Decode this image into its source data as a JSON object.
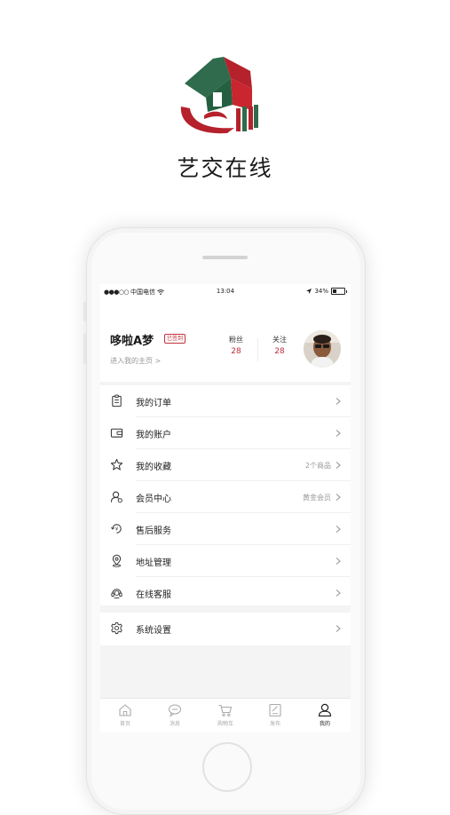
{
  "app": {
    "name": "艺交在线"
  },
  "status_bar": {
    "carrier": "中国电信",
    "time": "13:04",
    "battery": "34%"
  },
  "profile": {
    "username": "哆啦A梦",
    "badge": "已签到",
    "home_link": "进入我的主页 >",
    "fans_label": "粉丝",
    "fans_count": "28",
    "follow_label": "关注",
    "follow_count": "28"
  },
  "menu": {
    "items": [
      {
        "label": "我的订单",
        "value": "",
        "icon": "clipboard-icon"
      },
      {
        "label": "我的账户",
        "value": "",
        "icon": "wallet-icon"
      },
      {
        "label": "我的收藏",
        "value": "2个商品",
        "icon": "star-icon"
      },
      {
        "label": "会员中心",
        "value": "黄金会员",
        "icon": "member-icon"
      },
      {
        "label": "售后服务",
        "value": "",
        "icon": "service-icon"
      },
      {
        "label": "地址管理",
        "value": "",
        "icon": "location-icon"
      },
      {
        "label": "在线客服",
        "value": "",
        "icon": "headset-icon"
      }
    ],
    "settings": {
      "label": "系统设置",
      "icon": "gear-icon"
    }
  },
  "tabbar": {
    "tabs": [
      {
        "label": "首页",
        "icon": "home-icon"
      },
      {
        "label": "消息",
        "icon": "message-icon"
      },
      {
        "label": "购物车",
        "icon": "cart-icon"
      },
      {
        "label": "发布",
        "icon": "publish-icon"
      },
      {
        "label": "我的",
        "icon": "user-icon",
        "active": true
      }
    ]
  },
  "colors": {
    "accent": "#c0303a",
    "logo_green": "#2f6b4c",
    "logo_red": "#b5222c"
  }
}
